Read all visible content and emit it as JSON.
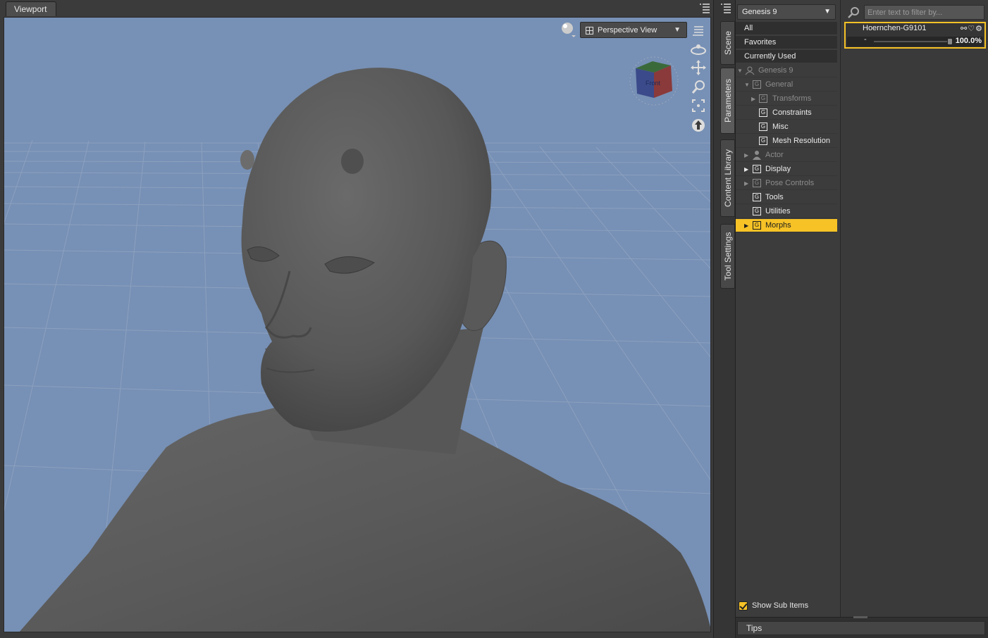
{
  "viewport": {
    "tab_label": "Viewport",
    "camera_label": "Perspective View",
    "cube_face_label": "Front",
    "colors": {
      "background": "#7790b5",
      "figure": "#5c5c5c",
      "grid": "#8fa3c1"
    }
  },
  "side_tabs": [
    {
      "label": "Scene"
    },
    {
      "label": "Parameters"
    },
    {
      "label": "Content Library"
    },
    {
      "label": "Tool Settings"
    }
  ],
  "parameters": {
    "figure_select": "Genesis 9",
    "groups": [
      "All",
      "Favorites",
      "Currently Used"
    ],
    "tree": [
      {
        "label": "Genesis 9",
        "state": "dim"
      },
      {
        "label": "General",
        "state": "dim"
      },
      {
        "label": "Transforms",
        "state": "dim"
      },
      {
        "label": "Constraints",
        "state": "normal"
      },
      {
        "label": "Misc",
        "state": "normal"
      },
      {
        "label": "Mesh Resolution",
        "state": "normal"
      },
      {
        "label": "Actor",
        "state": "dim"
      },
      {
        "label": "Display",
        "state": "normal"
      },
      {
        "label": "Pose Controls",
        "state": "dim"
      },
      {
        "label": "Tools",
        "state": "normal"
      },
      {
        "label": "Utilities",
        "state": "normal"
      },
      {
        "label": "Morphs",
        "state": "selected"
      }
    ],
    "show_sub_items_label": "Show Sub Items",
    "show_sub_items_checked": true,
    "filter_placeholder": "Enter text to filter by...",
    "morph": {
      "name": "Hoernchen-G9101",
      "value_text": "100.0%",
      "value": 1.0,
      "minus": "-"
    },
    "accent_color": "#f6c226"
  },
  "tips_label": "Tips"
}
